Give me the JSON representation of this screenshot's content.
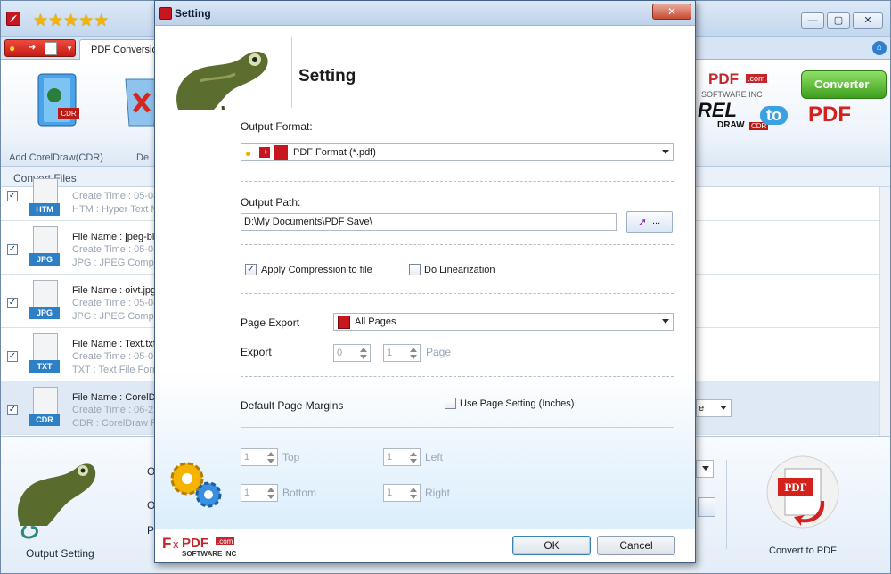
{
  "main_window": {
    "rating_stars": 5,
    "tab_label": "PDF Conversion",
    "ribbon": {
      "add_label": "Add CorelDraw(CDR)",
      "delete_label_partial": "De",
      "brand_top": "PDF",
      "brand_com": ".com",
      "brand_sub": "SOFTWARE INC",
      "logo_left": "REL",
      "logo_draw": "DRAW",
      "logo_cdr": "CDR",
      "logo_to": "to",
      "logo_pdf": "PDF",
      "converter_button": "Converter"
    },
    "convert_files_label": "Convert Files",
    "files": [
      {
        "badge": "HTM",
        "name": "",
        "created": "Create Time : 05-04",
        "type": "HTM : Hyper Text M",
        "checked": true,
        "selected": false
      },
      {
        "badge": "JPG",
        "name": "File Name : jpeg-bit",
        "created": "Create Time : 05-04",
        "type": "JPG : JPEG Compre",
        "checked": true,
        "selected": false
      },
      {
        "badge": "JPG",
        "name": "File Name : oivt.jpg",
        "created": "Create Time : 05-04",
        "type": "JPG : JPEG Compre",
        "checked": true,
        "selected": false
      },
      {
        "badge": "TXT",
        "name": "File Name : Text.txt",
        "created": "Create Time : 05-04",
        "type": "TXT : Text File Form",
        "checked": true,
        "selected": false
      },
      {
        "badge": "CDR",
        "name": "File Name : CorelDra",
        "created": "Create Time : 06-27",
        "type": "CDR : CorelDraw Fi",
        "checked": true,
        "selected": true
      }
    ],
    "row_combo_text": "e",
    "bottom": {
      "output_setting_label": "Output Setting",
      "field_o1": "O",
      "field_o2": "O",
      "field_p": "P",
      "convert_label": "Convert to PDF",
      "pdf_badge": "PDF"
    }
  },
  "dialog": {
    "title": "Setting",
    "heading": "Setting",
    "output_format_label": "Output Format:",
    "output_format_value": "PDF Format (*.pdf)",
    "output_path_label": "Output Path:",
    "output_path_value": "D:\\My Documents\\PDF Save\\",
    "browse_label": "...",
    "apply_compression_label": "Apply Compression to file",
    "apply_compression_checked": true,
    "linearization_label": "Do Linearization",
    "linearization_checked": false,
    "page_export_label": "Page Export",
    "page_export_value": "All Pages",
    "export_label": "Export",
    "export_from": "0",
    "export_to": "1",
    "page_label": "Page",
    "margins_label": "Default Page Margins",
    "use_page_setting_label": "Use Page Setting (Inches)",
    "use_page_setting_checked": false,
    "margins": {
      "top_value": "1",
      "top_label": "Top",
      "left_value": "1",
      "left_label": "Left",
      "bottom_value": "1",
      "bottom_label": "Bottom",
      "right_value": "1",
      "right_label": "Right"
    },
    "logo": {
      "fox": "F",
      "ox": "x",
      "pdf": "PDF",
      "com": ".com",
      "sub": "SOFTWARE INC"
    },
    "ok_label": "OK",
    "cancel_label": "Cancel"
  },
  "colors": {
    "accent_blue": "#3c7fb1",
    "converter_green": "#4cb52c",
    "pdf_red": "#c8161e"
  }
}
